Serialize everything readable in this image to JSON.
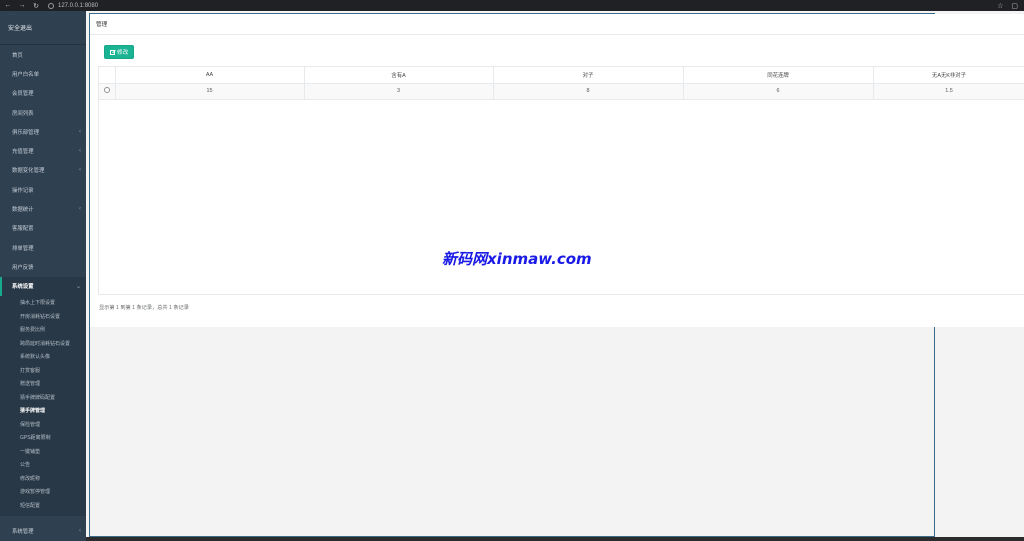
{
  "browser": {
    "url": "127.0.0.1:8080"
  },
  "sidebar": {
    "logout": "安全退出",
    "items": [
      {
        "label": "首页",
        "arrow": false
      },
      {
        "label": "用户白名单",
        "arrow": false
      },
      {
        "label": "会员管理",
        "arrow": false
      },
      {
        "label": "房间列表",
        "arrow": false
      },
      {
        "label": "俱乐部管理",
        "arrow": true
      },
      {
        "label": "充值管理",
        "arrow": true
      },
      {
        "label": "数据变化管理",
        "arrow": true
      },
      {
        "label": "操作记录",
        "arrow": false
      },
      {
        "label": "数据统计",
        "arrow": true
      },
      {
        "label": "客服配置",
        "arrow": false
      },
      {
        "label": "排单管理",
        "arrow": false
      },
      {
        "label": "用户反馈",
        "arrow": false
      }
    ],
    "open_section": "系统设置",
    "sub_items": [
      "抽水上下限设置",
      "开房消耗钻石设置",
      "服务费比例",
      "跨局延时消耗钻石设置",
      "系统默认头像",
      "打赏客服",
      "赠送管理",
      "猜手牌牌码配置",
      "猜手牌管理",
      "保险管理",
      "GPS距离限制",
      "一键铺垫",
      "公告",
      "修改昵称",
      "游戏暂停管理",
      "短信配置"
    ],
    "active_sub": 8,
    "bottom_item": "系统管理"
  },
  "page": {
    "title": "管理",
    "edit_button": "修改",
    "columns": [
      "AA",
      "含有A",
      "对子",
      "同花连牌",
      "无A无K非对子"
    ],
    "rows": [
      [
        "15",
        "3",
        "8",
        "6",
        "1.5"
      ]
    ],
    "pagination": "显示第 1 到第 1 条记录，总共 1 条记录"
  },
  "watermark": "新码网xinmaw.com",
  "colors": {
    "sidebar_bg": "#2f4050",
    "accent": "#1ab394",
    "watermark": "#1a1ae6"
  }
}
